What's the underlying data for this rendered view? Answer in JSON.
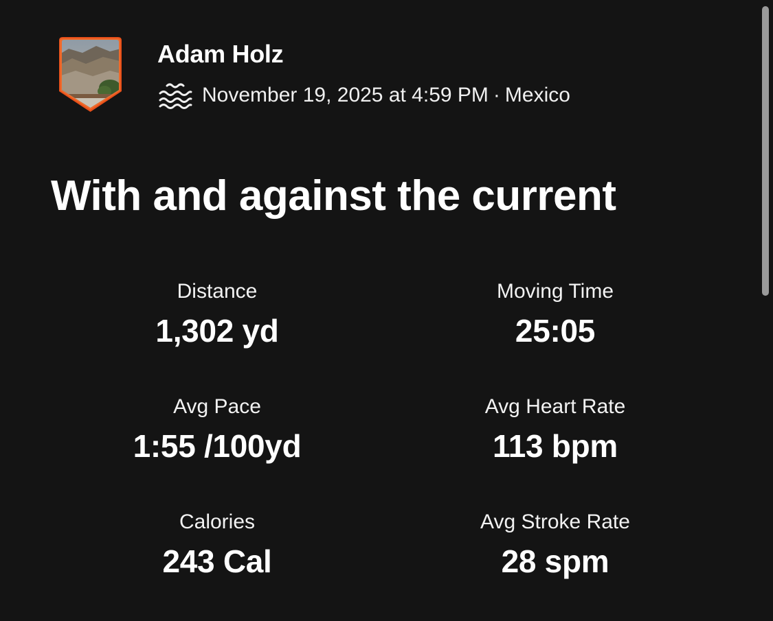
{
  "athlete": {
    "name": "Adam Holz",
    "avatar_icon": "profile-photo-shield",
    "avatar_border_color": "#fc5200"
  },
  "activity": {
    "sport_icon": "swim-icon",
    "date": "November 19, 2025 at 4:59 PM",
    "separator": "·",
    "location": "Mexico",
    "title": "With and against the current"
  },
  "stats": [
    {
      "label": "Distance",
      "value": "1,302 yd"
    },
    {
      "label": "Moving Time",
      "value": "25:05"
    },
    {
      "label": "Avg Pace",
      "value": "1:55 /100yd"
    },
    {
      "label": "Avg Heart Rate",
      "value": "113 bpm"
    },
    {
      "label": "Calories",
      "value": "243 Cal"
    },
    {
      "label": "Avg Stroke Rate",
      "value": "28 spm"
    }
  ],
  "colors": {
    "background": "#141414",
    "text": "#ffffff",
    "accent": "#fc5200"
  }
}
